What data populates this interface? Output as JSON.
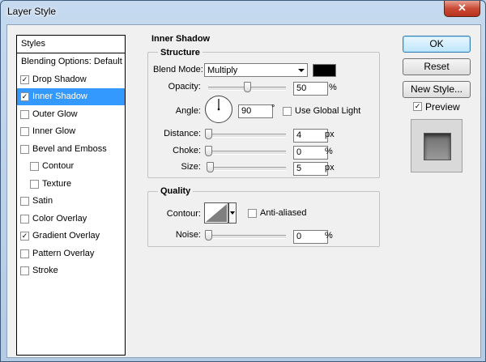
{
  "window": {
    "title": "Layer Style",
    "close_glyph": "✕"
  },
  "styles_panel": {
    "header": "Styles",
    "items": [
      {
        "label": "Blending Options: Default",
        "checkbox": false,
        "checked": false,
        "selected": false,
        "indent": false
      },
      {
        "label": "Drop Shadow",
        "checkbox": true,
        "checked": true,
        "selected": false,
        "indent": false
      },
      {
        "label": "Inner Shadow",
        "checkbox": true,
        "checked": true,
        "selected": true,
        "indent": false
      },
      {
        "label": "Outer Glow",
        "checkbox": true,
        "checked": false,
        "selected": false,
        "indent": false
      },
      {
        "label": "Inner Glow",
        "checkbox": true,
        "checked": false,
        "selected": false,
        "indent": false
      },
      {
        "label": "Bevel and Emboss",
        "checkbox": true,
        "checked": false,
        "selected": false,
        "indent": false
      },
      {
        "label": "Contour",
        "checkbox": true,
        "checked": false,
        "selected": false,
        "indent": true
      },
      {
        "label": "Texture",
        "checkbox": true,
        "checked": false,
        "selected": false,
        "indent": true
      },
      {
        "label": "Satin",
        "checkbox": true,
        "checked": false,
        "selected": false,
        "indent": false
      },
      {
        "label": "Color Overlay",
        "checkbox": true,
        "checked": false,
        "selected": false,
        "indent": false
      },
      {
        "label": "Gradient Overlay",
        "checkbox": true,
        "checked": true,
        "selected": false,
        "indent": false
      },
      {
        "label": "Pattern Overlay",
        "checkbox": true,
        "checked": false,
        "selected": false,
        "indent": false
      },
      {
        "label": "Stroke",
        "checkbox": true,
        "checked": false,
        "selected": false,
        "indent": false
      }
    ]
  },
  "inner_shadow": {
    "title": "Inner Shadow",
    "structure": {
      "title": "Structure",
      "blend_mode": {
        "label": "Blend Mode:",
        "value": "Multiply",
        "color": "#000000"
      },
      "opacity": {
        "label": "Opacity:",
        "value": "50",
        "unit": "%",
        "slider": 0.5
      },
      "angle": {
        "label": "Angle:",
        "value": "90",
        "unit": "°",
        "degrees": 90,
        "use_global_light": "Use Global Light",
        "global_checked": false
      },
      "distance": {
        "label": "Distance:",
        "value": "4",
        "unit": "px",
        "slider": 0.0
      },
      "choke": {
        "label": "Choke:",
        "value": "0",
        "unit": "%",
        "slider": 0.0
      },
      "size": {
        "label": "Size:",
        "value": "5",
        "unit": "px",
        "slider": 0.02
      }
    },
    "quality": {
      "title": "Quality",
      "contour_label": "Contour:",
      "anti_aliased": "Anti-aliased",
      "anti_aliased_checked": false,
      "noise": {
        "label": "Noise:",
        "value": "0",
        "unit": "%",
        "slider": 0.0
      }
    }
  },
  "buttons": {
    "ok": "OK",
    "reset": "Reset",
    "new_style": "New Style..."
  },
  "preview": {
    "label": "Preview",
    "checked": true
  },
  "colors": {
    "selection": "#3399ff",
    "titlebar": "#b9d1ea",
    "close": "#c94a36"
  }
}
